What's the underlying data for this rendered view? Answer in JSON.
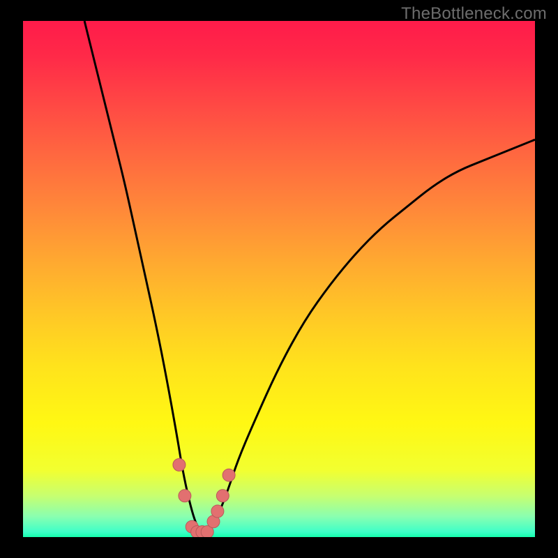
{
  "watermark": {
    "text": "TheBottleneck.com"
  },
  "colors": {
    "background": "#000000",
    "curve_stroke": "#000000",
    "marker_fill": "#e27070",
    "marker_stroke": "#b85a5a"
  },
  "chart_data": {
    "type": "line",
    "title": "",
    "xlabel": "",
    "ylabel": "",
    "xlim": [
      0,
      100
    ],
    "ylim": [
      0,
      100
    ],
    "series": [
      {
        "name": "bottleneck-curve",
        "x": [
          12,
          14,
          16,
          18,
          20,
          22,
          24,
          26,
          28,
          30,
          31,
          32,
          33,
          34,
          35,
          36,
          37,
          38,
          40,
          42,
          45,
          50,
          55,
          60,
          65,
          70,
          75,
          80,
          85,
          90,
          95,
          100
        ],
        "y": [
          100,
          92,
          84,
          76,
          68,
          59,
          50,
          41,
          31,
          20,
          14,
          9,
          5,
          2,
          1,
          1,
          2,
          4,
          9,
          15,
          22,
          33,
          42,
          49,
          55,
          60,
          64,
          68,
          71,
          73,
          75,
          77
        ]
      }
    ],
    "markers": {
      "name": "highlighted-points",
      "x": [
        30.5,
        31.6,
        33.0,
        34.0,
        35.0,
        36.0,
        37.2,
        38.0,
        39.0,
        40.2
      ],
      "y": [
        14,
        8,
        2,
        1,
        1,
        1,
        3,
        5,
        8,
        12
      ]
    }
  }
}
